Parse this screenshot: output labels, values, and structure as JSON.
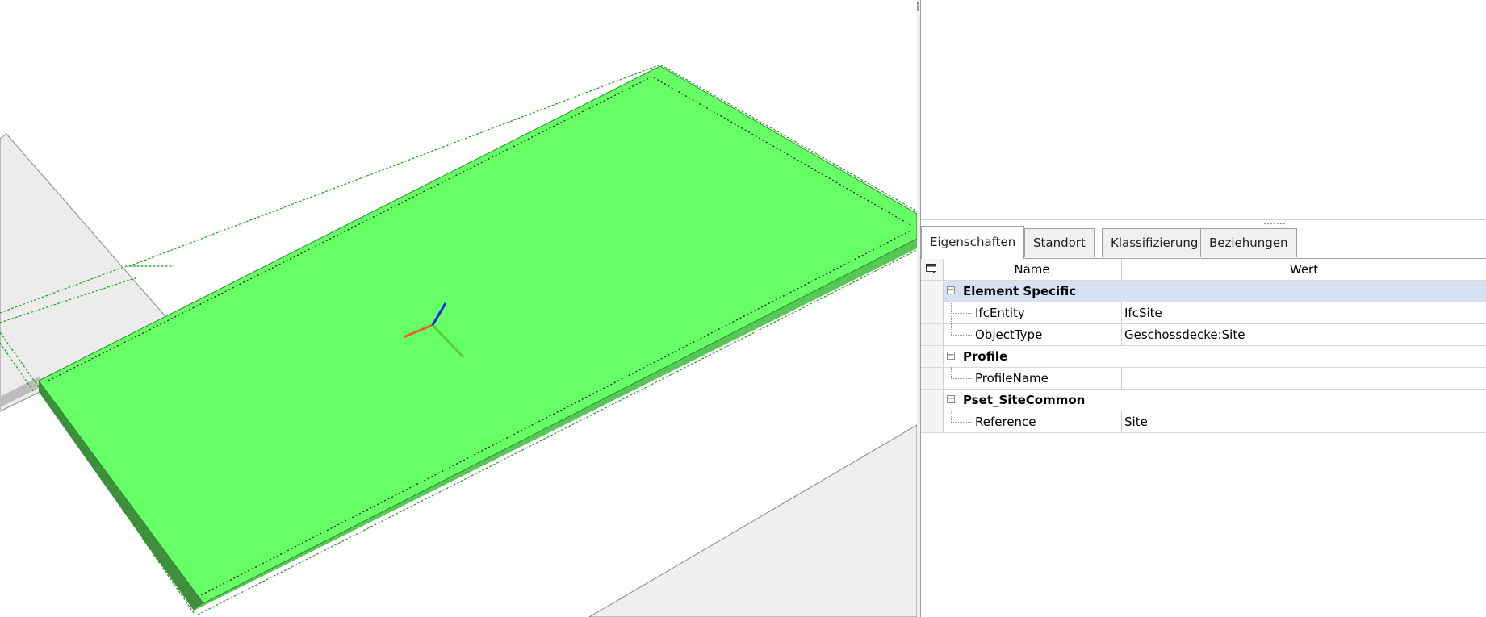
{
  "tabs": [
    {
      "label": "Eigenschaften",
      "active": true
    },
    {
      "label": "Standort",
      "active": false
    },
    {
      "label": "Klassifizierung",
      "active": false
    },
    {
      "label": "Beziehungen",
      "active": false
    }
  ],
  "grid": {
    "columns": {
      "name": "Name",
      "value": "Wert"
    },
    "groups": [
      {
        "label": "Element Specific",
        "selected": true,
        "rows": [
          {
            "name": "IfcEntity",
            "value": "IfcSite"
          },
          {
            "name": "ObjectType",
            "value": "Geschossdecke:Site"
          }
        ]
      },
      {
        "label": "Profile",
        "selected": false,
        "rows": [
          {
            "name": "ProfileName",
            "value": ""
          }
        ]
      },
      {
        "label": "Pset_SiteCommon",
        "selected": false,
        "rows": [
          {
            "name": "Reference",
            "value": "Site"
          }
        ]
      }
    ]
  },
  "colors": {
    "selection_green": "#66ff66",
    "group_highlight": "#d6e1f1",
    "axis_x": "#e06820",
    "axis_y": "#5acd3c",
    "axis_z": "#1428e6"
  },
  "icons": {
    "column_chooser": "table-settings-icon",
    "collapse": "minus-box-icon"
  }
}
